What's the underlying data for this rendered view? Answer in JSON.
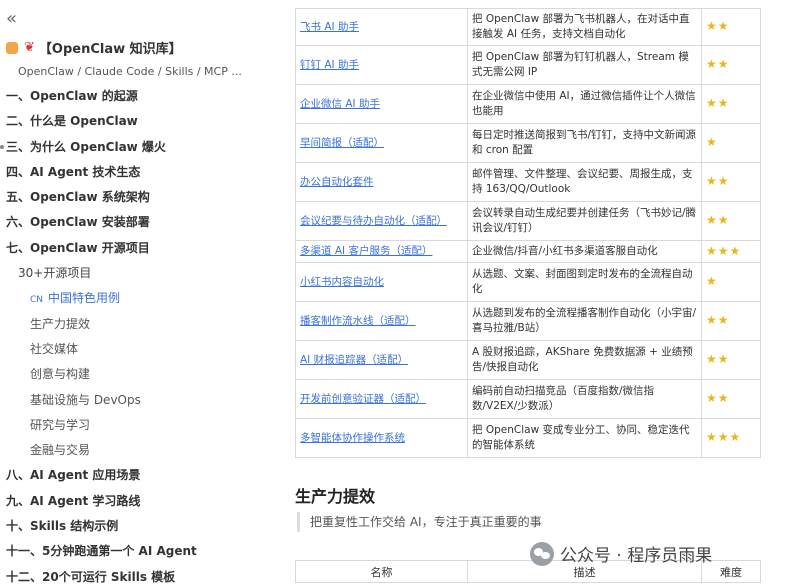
{
  "sidebar": {
    "collapse_glyph": "«",
    "kb_title": "【OpenClaw 知识库】",
    "kb_subtitle": "OpenClaw / Claude Code / Skills / MCP ...",
    "items": [
      {
        "label": "一、OpenClaw 的起源",
        "level": 1
      },
      {
        "label": "二、什么是 OpenClaw",
        "level": 1
      },
      {
        "label": "三、为什么 OpenClaw 爆火",
        "level": 1
      },
      {
        "label": "四、AI Agent 技术生态",
        "level": 1
      },
      {
        "label": "五、OpenClaw 系统架构",
        "level": 1
      },
      {
        "label": "六、OpenClaw 安装部署",
        "level": 1
      },
      {
        "label": "七、OpenClaw 开源项目",
        "level": 1
      },
      {
        "label": "30+开源项目",
        "level": 2
      },
      {
        "label": "中国特色用例",
        "level": 3,
        "badge": "CN",
        "active": true
      },
      {
        "label": "生产力提效",
        "level": 3
      },
      {
        "label": "社交媒体",
        "level": 3
      },
      {
        "label": "创意与构建",
        "level": 3
      },
      {
        "label": "基础设施与 DevOps",
        "level": 3
      },
      {
        "label": "研究与学习",
        "level": 3
      },
      {
        "label": "金融与交易",
        "level": 3
      },
      {
        "label": "八、AI Agent 应用场景",
        "level": 1
      },
      {
        "label": "九、AI Agent 学习路线",
        "level": 1
      },
      {
        "label": "十、Skills 结构示例",
        "level": 1
      },
      {
        "label": "十一、5分钟跑通第一个 AI Agent",
        "level": 1
      },
      {
        "label": "十二、20个可运行 Skills 模板",
        "level": 1
      }
    ]
  },
  "projects": [
    {
      "name": "飞书 AI 助手",
      "desc": "把 OpenClaw 部署为飞书机器人，在对话中直接触发 AI 任务，支持文档自动化",
      "stars": "★★"
    },
    {
      "name": "钉钉 AI 助手",
      "desc": "把 OpenClaw 部署为钉钉机器人，Stream 模式无需公网 IP",
      "stars": "★★"
    },
    {
      "name": "企业微信 AI 助手",
      "desc": "在企业微信中使用 AI，通过微信插件让个人微信也能用",
      "stars": "★★"
    },
    {
      "name": "早间简报（适配）",
      "desc": "每日定时推送简报到飞书/钉钉，支持中文新闻源和 cron 配置",
      "stars": "★"
    },
    {
      "name": "办公自动化套件",
      "desc": "邮件管理、文件整理、会议纪要、周报生成，支持 163/QQ/Outlook",
      "stars": "★★"
    },
    {
      "name": "会议纪要与待办自动化（适配）",
      "desc": "会议转录自动生成纪要并创建任务（飞书妙记/腾讯会议/钉钉）",
      "stars": "★★"
    },
    {
      "name": "多渠道 AI 客户服务（适配）",
      "desc": "企业微信/抖音/小红书多渠道客服自动化",
      "stars": "★★★"
    },
    {
      "name": "小红书内容自动化",
      "desc": "从选题、文案、封面图到定时发布的全流程自动化",
      "stars": "★"
    },
    {
      "name": "播客制作流水线（适配）",
      "desc": "从选题到发布的全流程播客制作自动化（小宇宙/喜马拉雅/B站）",
      "stars": "★★"
    },
    {
      "name": "AI 财报追踪器（适配）",
      "desc": "A 股财报追踪，AKShare 免费数据源 + 业绩预告/快报自动化",
      "stars": "★★"
    },
    {
      "name": "开发前创意验证器（适配）",
      "desc": "编码前自动扫描竞品（百度指数/微信指数/V2EX/少数派）",
      "stars": "★★"
    },
    {
      "name": "多智能体协作操作系统",
      "desc": "把 OpenClaw 变成专业分工、协同、稳定迭代的智能体系统",
      "stars": "★★★"
    }
  ],
  "section": {
    "title": "生产力提效",
    "quote": "把重复性工作交给 AI，专注于真正重要的事"
  },
  "next_table_headers": [
    "名称",
    "描述",
    "难度"
  ],
  "watermark": "公众号 · 程序员雨果",
  "colors": {
    "link": "#3b72d9",
    "star": "#e8b71c",
    "border": "#d9d9d9"
  }
}
